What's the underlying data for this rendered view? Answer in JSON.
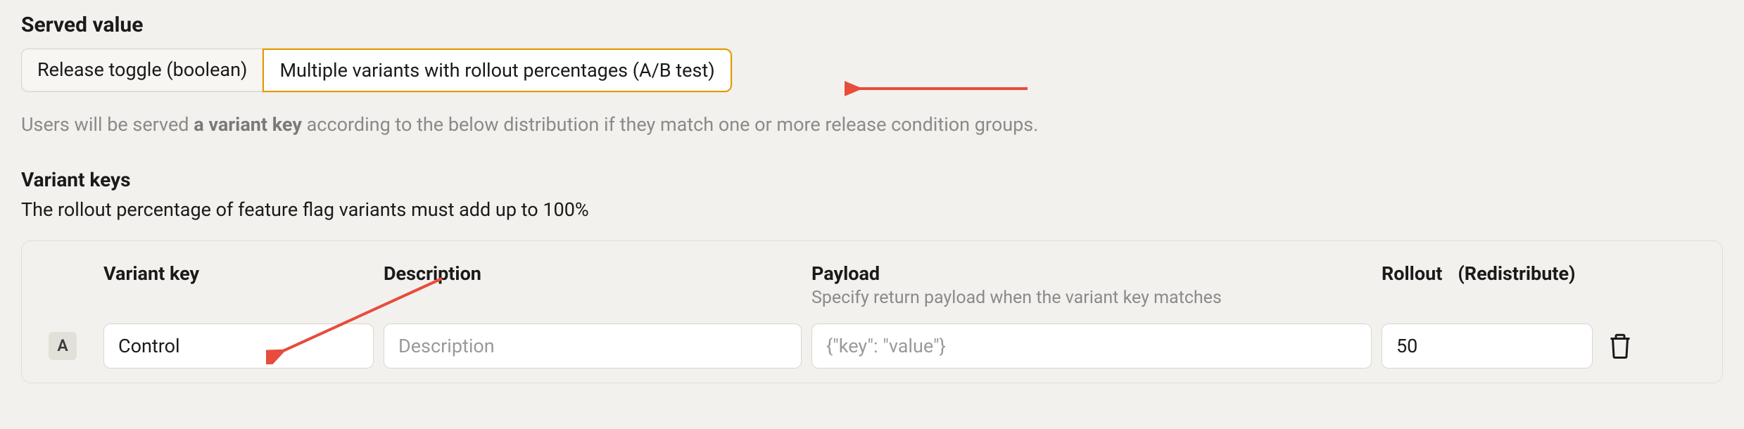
{
  "served_value": {
    "title": "Served value",
    "options": {
      "release_toggle": "Release toggle (boolean)",
      "multi_variant": "Multiple variants with rollout percentages (A/B test)"
    },
    "help_prefix": "Users will be served ",
    "help_bold": "a variant key",
    "help_suffix": " according to the below distribution if they match one or more release condition groups."
  },
  "variant_keys": {
    "title": "Variant keys",
    "help": "The rollout percentage of feature flag variants must add up to 100%",
    "columns": {
      "variant_key": "Variant key",
      "description": "Description",
      "payload": "Payload",
      "payload_sub": "Specify return payload when the variant key matches",
      "rollout": "Rollout",
      "redistribute": "(Redistribute)"
    },
    "rows": [
      {
        "badge": "A",
        "key": "Control",
        "description_placeholder": "Description",
        "payload_placeholder": "{\"key\": \"value\"}",
        "rollout": "50"
      }
    ]
  },
  "annotations": {
    "arrow1": true,
    "arrow2": true
  }
}
